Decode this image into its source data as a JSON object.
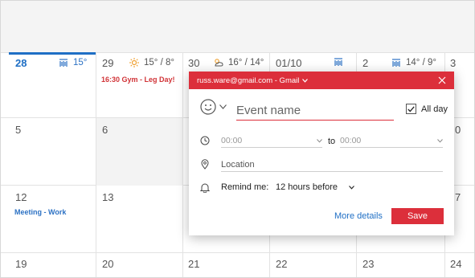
{
  "calendar": {
    "week1": {
      "days": [
        "28",
        "29",
        "30",
        "01/10",
        "2",
        "3"
      ],
      "weather": [
        "15°",
        "15° / 8°",
        "16° / 14°",
        "14° / 9°"
      ],
      "event_gym": "16:30 Gym - Leg Day!"
    },
    "week2": {
      "days": [
        "5",
        "6",
        "0"
      ]
    },
    "week3": {
      "days": [
        "12",
        "13",
        "7"
      ],
      "event_meeting": "Meeting - Work"
    },
    "week4": {
      "days": [
        "19",
        "20",
        "21",
        "22",
        "23",
        "24"
      ]
    },
    "colors": {
      "today": "#1f6fc5",
      "gym_event": "#d13438",
      "meeting_event": "#2d72c4",
      "weather_sun": "#f0a030"
    }
  },
  "popup": {
    "account": "russ.ware@gmail.com - Gmail",
    "event_placeholder": "Event name",
    "all_day": "All day",
    "all_day_checked": true,
    "start_time": "00:00",
    "to_label": "to",
    "end_time": "00:00",
    "location_placeholder": "Location",
    "remind_label": "Remind me:",
    "remind_value": "12 hours before",
    "more_details": "More details",
    "save": "Save",
    "accent": "#dc2f3b"
  }
}
